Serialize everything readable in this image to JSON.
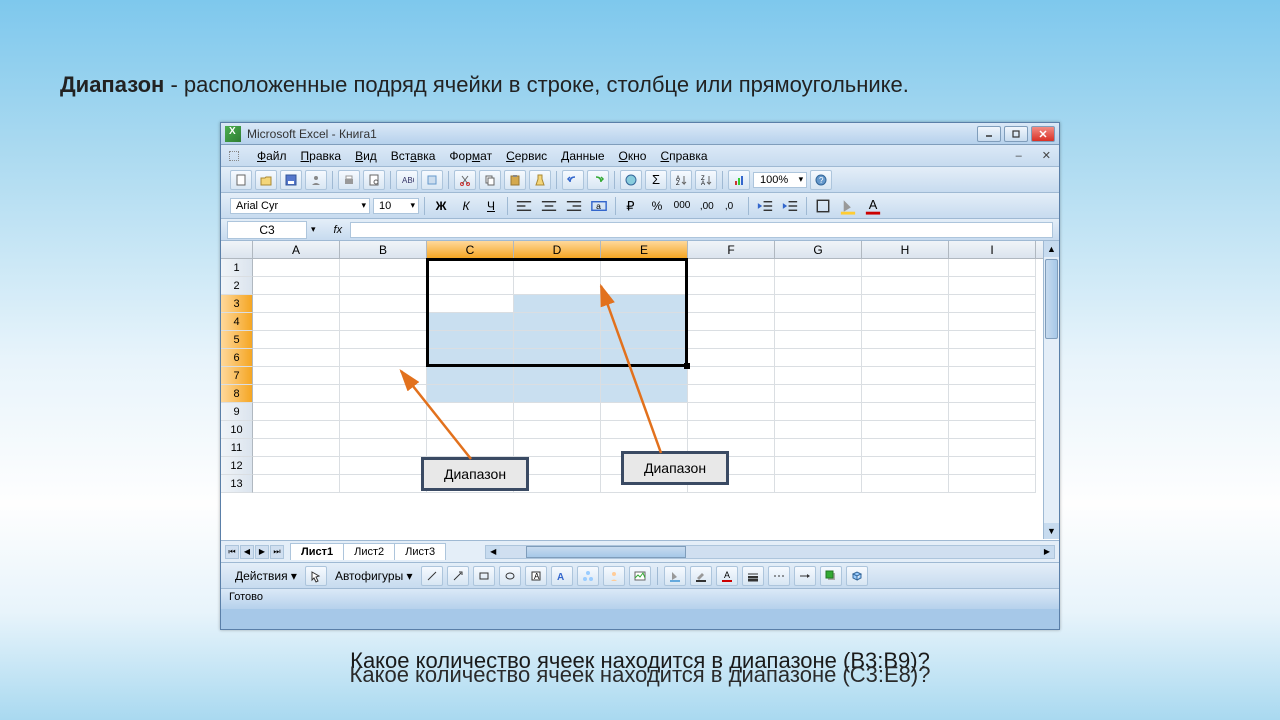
{
  "title_bold": "Диапазон",
  "title_rest": " - расположенные подряд ячейки в строке, столбце или прямоугольнике.",
  "window_title": "Microsoft Excel - Книга1",
  "menus": [
    "Файл",
    "Правка",
    "Вид",
    "Вставка",
    "Формат",
    "Сервис",
    "Данные",
    "Окно",
    "Справка"
  ],
  "font_name": "Arial Cyr",
  "font_size": "10",
  "name_box": "C3",
  "zoom": "100%",
  "columns": [
    "A",
    "B",
    "C",
    "D",
    "E",
    "F",
    "G",
    "H",
    "I"
  ],
  "rows": [
    "1",
    "2",
    "3",
    "4",
    "5",
    "6",
    "7",
    "8",
    "9",
    "10",
    "11",
    "12",
    "13"
  ],
  "selected_cols": [
    "C",
    "D",
    "E"
  ],
  "selected_rows": [
    "3",
    "4",
    "5",
    "6",
    "7",
    "8"
  ],
  "active_cell": "C3",
  "sheets": [
    "Лист1",
    "Лист2",
    "Лист3"
  ],
  "drawing_label": "Действия",
  "autoshapes": "Автофигуры",
  "status": "Готово",
  "callout1": "Диапазон",
  "callout2": "Диапазон",
  "question1": "Какое количество ячеек находится в диапазоне (B3:B9)?",
  "question2": "Какое количество ячеек находится в диапазоне (C3:E8)?"
}
